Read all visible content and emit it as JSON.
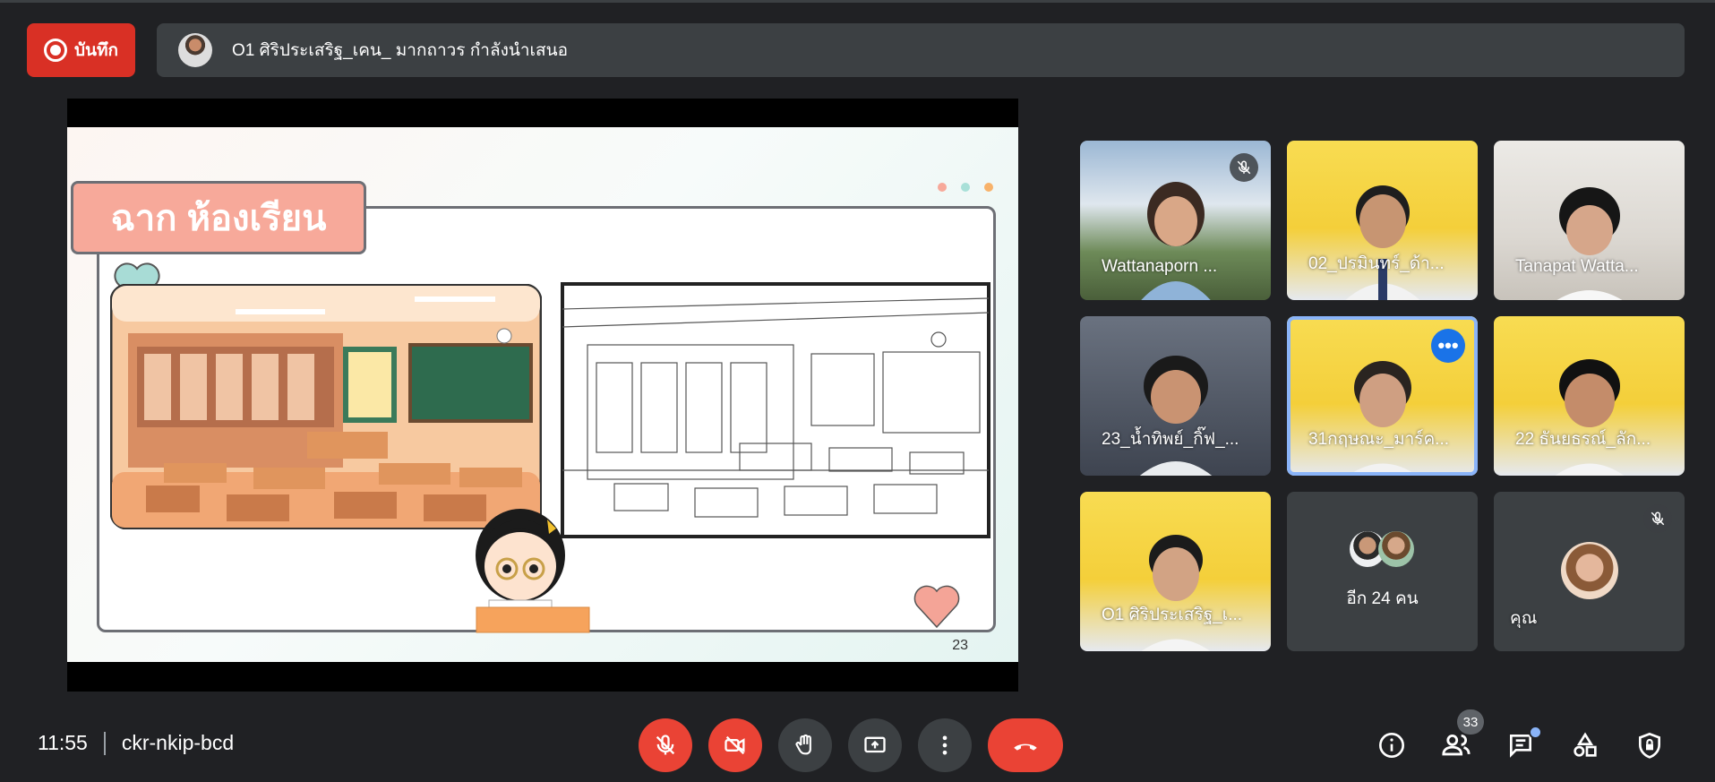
{
  "record": {
    "label": "บันทึก"
  },
  "presenter": {
    "text": "O1 ศิริประเสริฐ_เคน_ มากถาวร กำลังนำเสนอ"
  },
  "slide": {
    "title": "ฉาก ห้องเรียน",
    "page": "23"
  },
  "participants": [
    {
      "name": "Wattanaporn ...",
      "muted": true
    },
    {
      "name": "02_ปรมินทร์_ด้า...",
      "muted": false
    },
    {
      "name": "Tanapat Watta...",
      "muted": false
    },
    {
      "name": "23_น้ำทิพย์_กิ๊ฟ_...",
      "muted": false
    },
    {
      "name": "31กฤษณะ_มาร์ค...",
      "muted": false,
      "active": true
    },
    {
      "name": "22 ธันยธรณ์_ลัก...",
      "muted": false
    },
    {
      "name": "O1 ศิริประเสริฐ_เ...",
      "muted": false
    }
  ],
  "others": {
    "label": "อีก 24 คน"
  },
  "self": {
    "label": "คุณ",
    "muted": true
  },
  "meeting": {
    "time": "11:55",
    "code": "ckr-nkip-bcd"
  },
  "people_count": "33",
  "colors": {
    "red": "#ea4335",
    "panel": "#3c4043",
    "background": "#202124",
    "accent": "#8ab4f8"
  }
}
